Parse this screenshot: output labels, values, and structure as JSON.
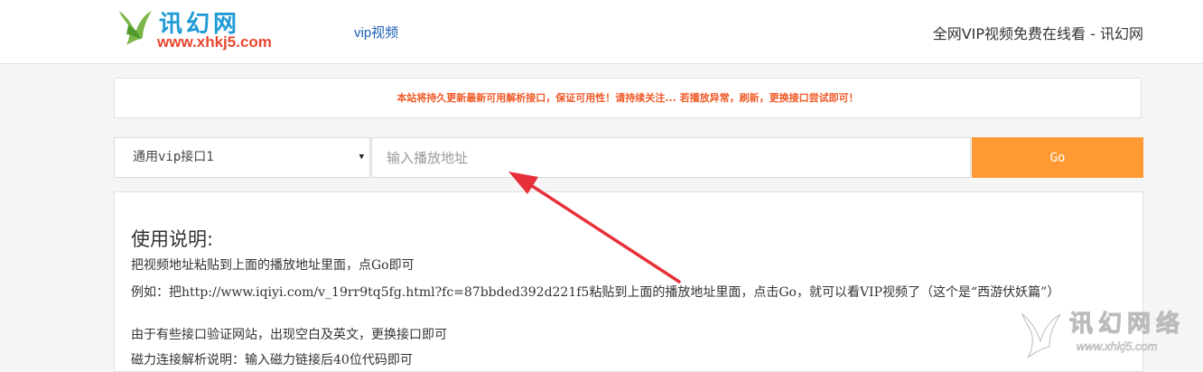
{
  "header": {
    "logo_title": "讯幻网",
    "logo_url": "www.xhkj5.com",
    "nav_link": "vip视频",
    "site_tagline": "全网VIP视频免费在线看 - 讯幻网"
  },
  "notice": {
    "text": "本站将持久更新最新可用解析接口，保证可用性！请持续关注...  若播放异常，刷新，更换接口尝试即可！"
  },
  "form": {
    "select_value": "通用vip接口1",
    "input_placeholder": "输入播放地址",
    "go_label": "Go"
  },
  "instructions": {
    "title": "使用说明:",
    "line1": "把视频地址粘贴到上面的播放地址里面，点Go即可",
    "line2": "例如：把http://www.iqiyi.com/v_19rr9tq5fg.html?fc=87bbded392d221f5粘贴到上面的播放地址里面，点击Go，就可以看VIP视频了（这个是“西游伏妖篇”）",
    "line3": "由于有些接口验证网站，出现空白及英文，更换接口即可",
    "line4": "磁力连接解析说明：输入磁力链接后40位代码即可"
  },
  "watermark": {
    "title": "讯幻网络",
    "url": "www.xhkj5.com"
  },
  "colors": {
    "accent": "#ff9933",
    "notice_text": "#f05a28",
    "arrow": "#e8303a",
    "link": "#1a5fb4"
  }
}
